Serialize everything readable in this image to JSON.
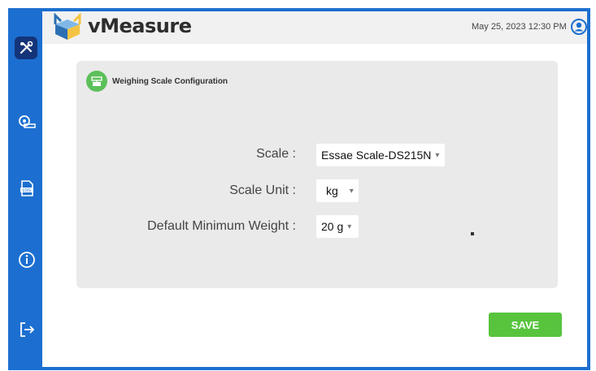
{
  "app": {
    "name": "vMeasure"
  },
  "header": {
    "datetime": "May 25, 2023 12:30 PM"
  },
  "sidebar": {
    "items": [
      {
        "icon": "tools-icon",
        "active": true
      },
      {
        "icon": "measuring-tape-icon"
      },
      {
        "icon": "log-icon"
      },
      {
        "icon": "info-icon"
      },
      {
        "icon": "logout-icon"
      }
    ]
  },
  "panel": {
    "title": "Weighing Scale Configuration",
    "fields": [
      {
        "label": "Scale :",
        "value": "Essae Scale-DS215N"
      },
      {
        "label": "Scale Unit :",
        "value": "kg"
      },
      {
        "label": "Default Minimum Weight :",
        "value": "20 g"
      }
    ]
  },
  "actions": {
    "save_label": "SAVE"
  },
  "colors": {
    "frame": "#1c6fd0",
    "active_icon_bg": "#14347a",
    "save": "#58c43e",
    "panel_icon": "#5cc05a"
  }
}
